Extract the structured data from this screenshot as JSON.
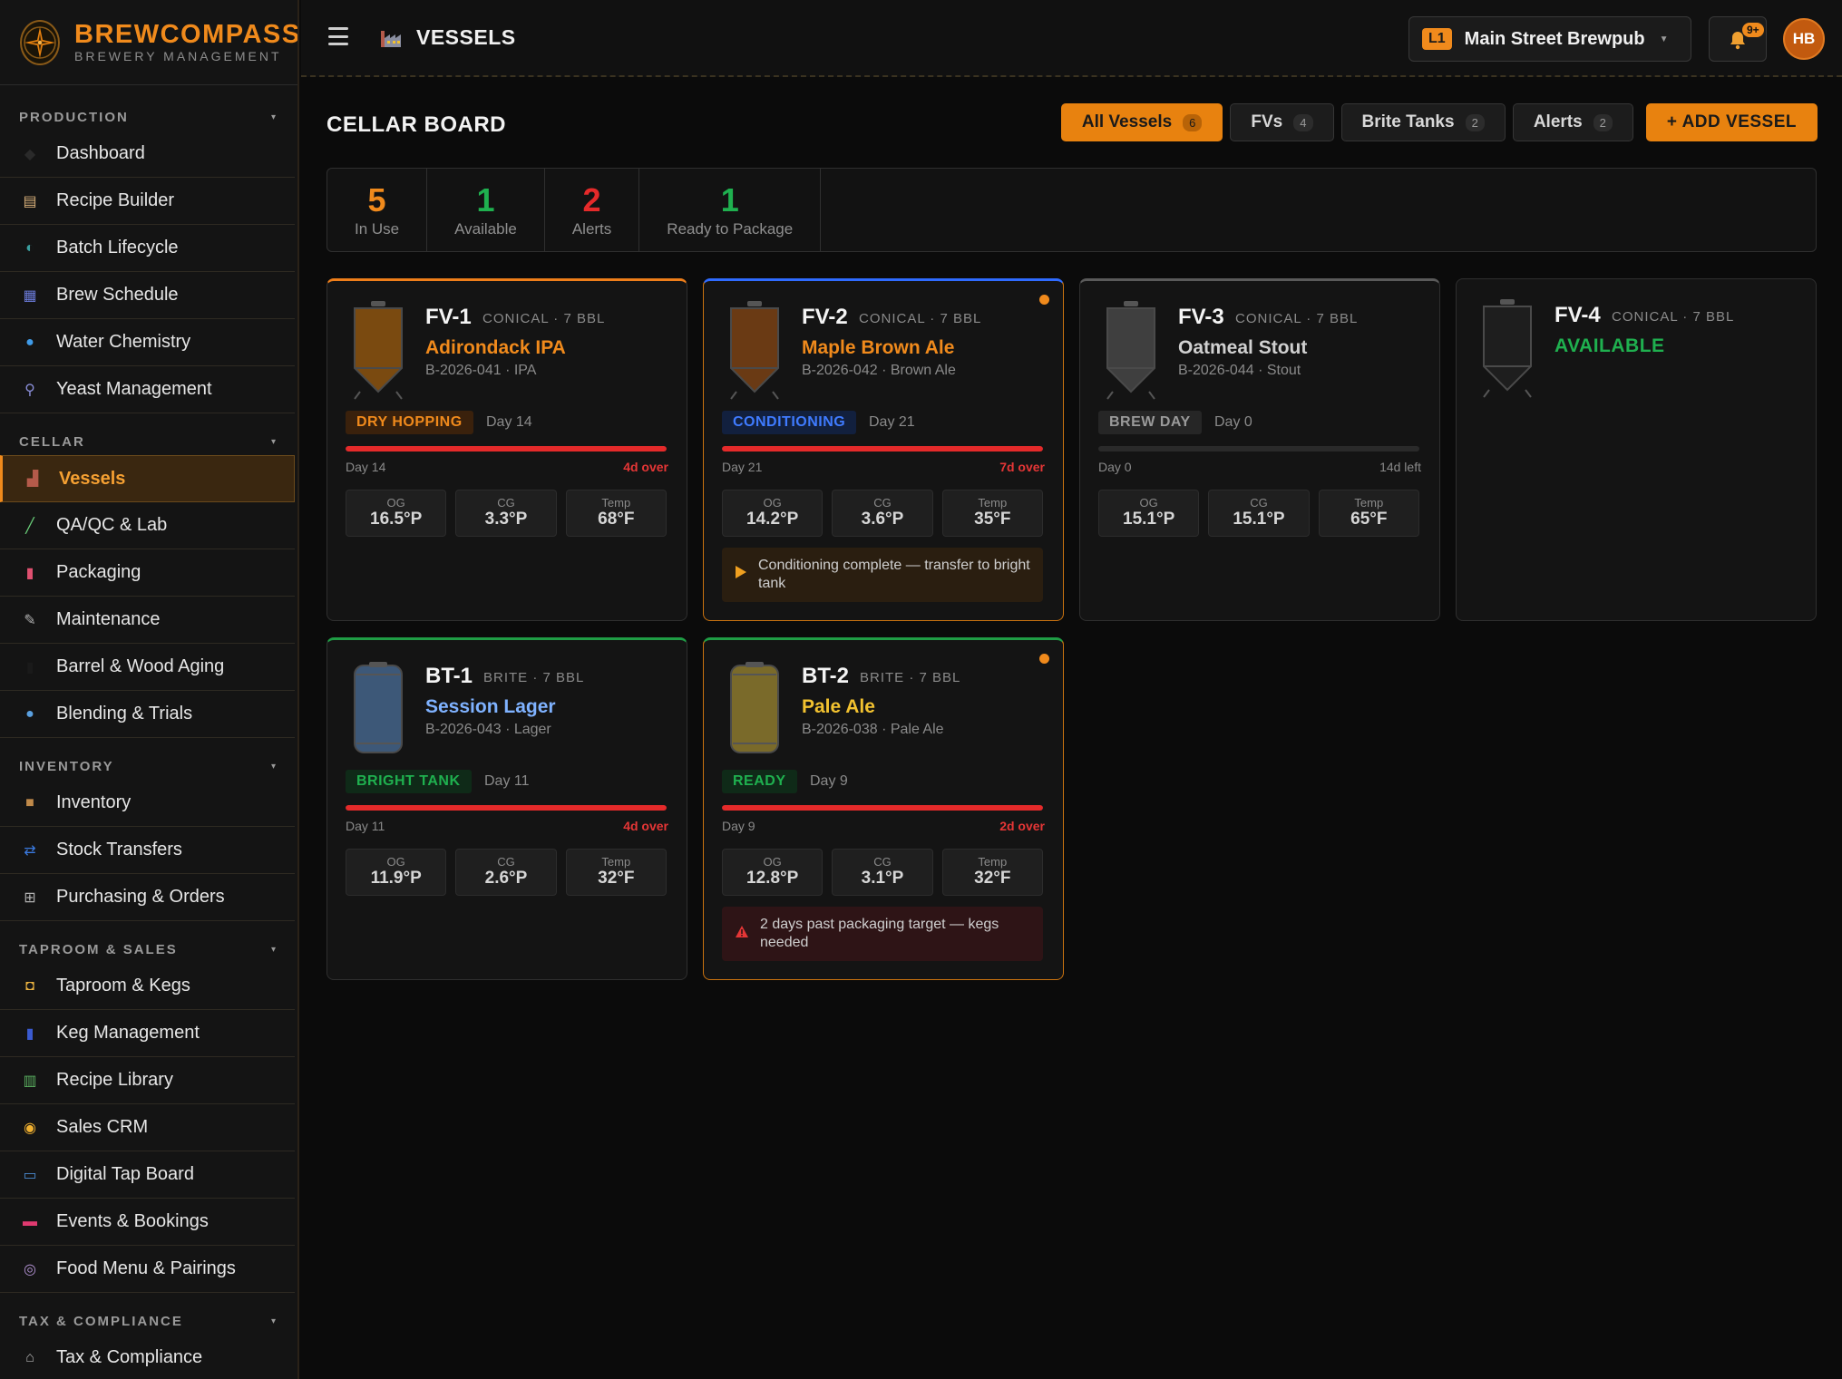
{
  "brand": {
    "name": "BREWCOMPASS",
    "subtitle": "BREWERY MANAGEMENT"
  },
  "sidebar": {
    "sections": [
      {
        "title": "PRODUCTION",
        "items": [
          {
            "label": "Dashboard",
            "icon": "diamond-icon"
          },
          {
            "label": "Recipe Builder",
            "icon": "clipboard-icon"
          },
          {
            "label": "Batch Lifecycle",
            "icon": "cycle-icon"
          },
          {
            "label": "Brew Schedule",
            "icon": "calendar-icon"
          },
          {
            "label": "Water Chemistry",
            "icon": "droplet-icon"
          },
          {
            "label": "Yeast Management",
            "icon": "microscope-icon"
          }
        ]
      },
      {
        "title": "CELLAR",
        "items": [
          {
            "label": "Vessels",
            "icon": "factory-icon",
            "active": true
          },
          {
            "label": "QA/QC & Lab",
            "icon": "test-tube-icon"
          },
          {
            "label": "Packaging",
            "icon": "can-icon"
          },
          {
            "label": "Maintenance",
            "icon": "wrench-icon"
          },
          {
            "label": "Barrel & Wood Aging",
            "icon": "barrel-icon"
          },
          {
            "label": "Blending & Trials",
            "icon": "blend-icon"
          }
        ]
      },
      {
        "title": "INVENTORY",
        "items": [
          {
            "label": "Inventory",
            "icon": "box-icon"
          },
          {
            "label": "Stock Transfers",
            "icon": "transfer-icon"
          },
          {
            "label": "Purchasing & Orders",
            "icon": "cart-icon"
          }
        ]
      },
      {
        "title": "TAPROOM & SALES",
        "items": [
          {
            "label": "Taproom & Kegs",
            "icon": "beer-icon"
          },
          {
            "label": "Keg Management",
            "icon": "keg-icon"
          },
          {
            "label": "Recipe Library",
            "icon": "books-icon"
          },
          {
            "label": "Sales CRM",
            "icon": "handshake-icon"
          },
          {
            "label": "Digital Tap Board",
            "icon": "tv-icon"
          },
          {
            "label": "Events & Bookings",
            "icon": "ticket-icon"
          },
          {
            "label": "Food Menu & Pairings",
            "icon": "plate-icon"
          }
        ]
      },
      {
        "title": "TAX & COMPLIANCE",
        "items": [
          {
            "label": "Tax & Compliance",
            "icon": "bank-icon"
          }
        ]
      }
    ]
  },
  "topbar": {
    "title": "VESSELS",
    "location_badge": "L1",
    "location_name": "Main Street Brewpub",
    "notifications": "9+",
    "avatar": "HB"
  },
  "board": {
    "title": "CELLAR BOARD",
    "filters": [
      {
        "label": "All Vessels",
        "count": "6",
        "active": true
      },
      {
        "label": "FVs",
        "count": "4"
      },
      {
        "label": "Brite Tanks",
        "count": "2"
      },
      {
        "label": "Alerts",
        "count": "2"
      }
    ],
    "add_label": "+ ADD VESSEL",
    "stats": [
      {
        "value": "5",
        "label": "In Use",
        "color": "#f08a1c"
      },
      {
        "value": "1",
        "label": "Available",
        "color": "#1fb04f"
      },
      {
        "value": "2",
        "label": "Alerts",
        "color": "#e52a2a"
      },
      {
        "value": "1",
        "label": "Ready to Package",
        "color": "#1fb04f"
      }
    ]
  },
  "vessels": [
    {
      "id": "FV-1",
      "type": "CONICAL · 7 BBL",
      "beer": "Adirondack IPA",
      "beer_color": "#f08a1c",
      "batch": "B-2026-041 · IPA",
      "phase": "DRY HOPPING",
      "phase_color": "#f08a1c",
      "phase_bg": "#3a210c",
      "day": "Day 14",
      "bar_left": "Day 14",
      "bar_right": "4d over",
      "progress": 1.0,
      "og": "16.5°P",
      "cg": "3.3°P",
      "temp": "68°F",
      "liquid": "#7a4a10",
      "alert_dot": false
    },
    {
      "id": "FV-2",
      "type": "CONICAL · 7 BBL",
      "beer": "Maple Brown Ale",
      "beer_color": "#f08a1c",
      "batch": "B-2026-042 · Brown Ale",
      "phase": "CONDITIONING",
      "phase_color": "#3f7bff",
      "phase_bg": "#12203e",
      "day": "Day 21",
      "bar_left": "Day 21",
      "bar_right": "7d over",
      "progress": 1.0,
      "og": "14.2°P",
      "cg": "3.6°P",
      "temp": "35°F",
      "liquid": "#6a3a14",
      "alert_dot": true,
      "note": "Conditioning complete — transfer to bright tank",
      "note_type": "play"
    },
    {
      "id": "FV-3",
      "type": "CONICAL · 7 BBL",
      "beer": "Oatmeal Stout",
      "beer_color": "#d0d0d0",
      "batch": "B-2026-044 · Stout",
      "phase": "BREW DAY",
      "phase_color": "#9a9a9a",
      "phase_bg": "#262626",
      "day": "Day 0",
      "bar_left": "Day 0",
      "bar_right": "14d left",
      "progress": 0.0,
      "og": "15.1°P",
      "cg": "15.1°P",
      "temp": "65°F",
      "liquid": "#3f3f3f",
      "alert_dot": false
    },
    {
      "id": "FV-4",
      "type": "CONICAL · 7 BBL",
      "available": "AVAILABLE",
      "liquid": "#1e1e1e"
    },
    {
      "id": "BT-1",
      "type": "BRITE · 7 BBL",
      "beer": "Session Lager",
      "beer_color": "#7fb2ff",
      "batch": "B-2026-043 · Lager",
      "phase": "BRIGHT TANK",
      "phase_color": "#1fb04f",
      "phase_bg": "#0f2a18",
      "day": "Day 11",
      "bar_left": "Day 11",
      "bar_right": "4d over",
      "progress": 1.0,
      "og": "11.9°P",
      "cg": "2.6°P",
      "temp": "32°F",
      "liquid": "#3d5878",
      "alert_dot": false
    },
    {
      "id": "BT-2",
      "type": "BRITE · 7 BBL",
      "beer": "Pale Ale",
      "beer_color": "#f2c230",
      "batch": "B-2026-038 · Pale Ale",
      "phase": "READY",
      "phase_color": "#1fb04f",
      "phase_bg": "#0f2a18",
      "day": "Day 9",
      "bar_left": "Day 9",
      "bar_right": "2d over",
      "progress": 1.0,
      "og": "12.8°P",
      "cg": "3.1°P",
      "temp": "32°F",
      "liquid": "#7a6a2a",
      "alert_dot": true,
      "note": "2 days past packaging target — kegs needed",
      "note_type": "warning"
    }
  ],
  "metric_labels": {
    "og": "OG",
    "cg": "CG",
    "temp": "Temp"
  }
}
